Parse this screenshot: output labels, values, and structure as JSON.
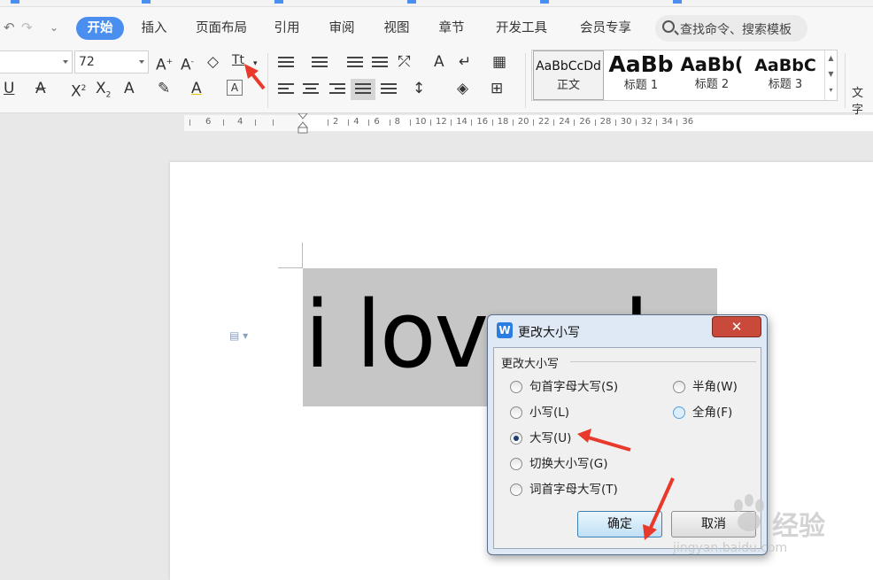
{
  "menubar": {
    "tabs": [
      "开始",
      "插入",
      "页面布局",
      "引用",
      "审阅",
      "视图",
      "章节",
      "开发工具",
      "会员专享"
    ],
    "active_tab": "开始",
    "search_placeholder": "查找命令、搜索模板"
  },
  "ribbon": {
    "font_size": "72",
    "styles": [
      {
        "sample": "AaBbCcDd",
        "label": "正文"
      },
      {
        "sample": "AaBb",
        "label": "标题 1"
      },
      {
        "sample": "AaBb(",
        "label": "标题 2"
      },
      {
        "sample": "AaBbC",
        "label": "标题 3"
      }
    ],
    "truncated_label": "文字"
  },
  "ruler": {
    "left_numbers": [
      "6",
      "4"
    ],
    "right_numbers": [
      "2",
      "4",
      "6",
      "8",
      "10",
      "12",
      "14",
      "16",
      "18",
      "20",
      "22",
      "24",
      "26",
      "28",
      "30",
      "32",
      "34",
      "36"
    ]
  },
  "document": {
    "text": "i love aba"
  },
  "dialog": {
    "title": "更改大小写",
    "close_label": "✕",
    "group_label": "更改大小写",
    "options_left": [
      {
        "label": "句首字母大写(S)",
        "checked": false
      },
      {
        "label": "小写(L)",
        "checked": false
      },
      {
        "label": "大写(U)",
        "checked": true
      },
      {
        "label": "切换大小写(G)",
        "checked": false
      },
      {
        "label": "词首字母大写(T)",
        "checked": false
      }
    ],
    "options_right": [
      {
        "label": "半角(W)",
        "checked": false
      },
      {
        "label": "全角(F)",
        "checked": false
      }
    ],
    "ok_label": "确定",
    "cancel_label": "取消"
  },
  "watermark": {
    "main": "经验",
    "url": "jingyan.baidu.com"
  },
  "colors": {
    "accent": "#4a8ff0",
    "annotation_arrow": "#e8392a",
    "selection": "#c6c6c6",
    "close_button": "#c94a3b"
  }
}
